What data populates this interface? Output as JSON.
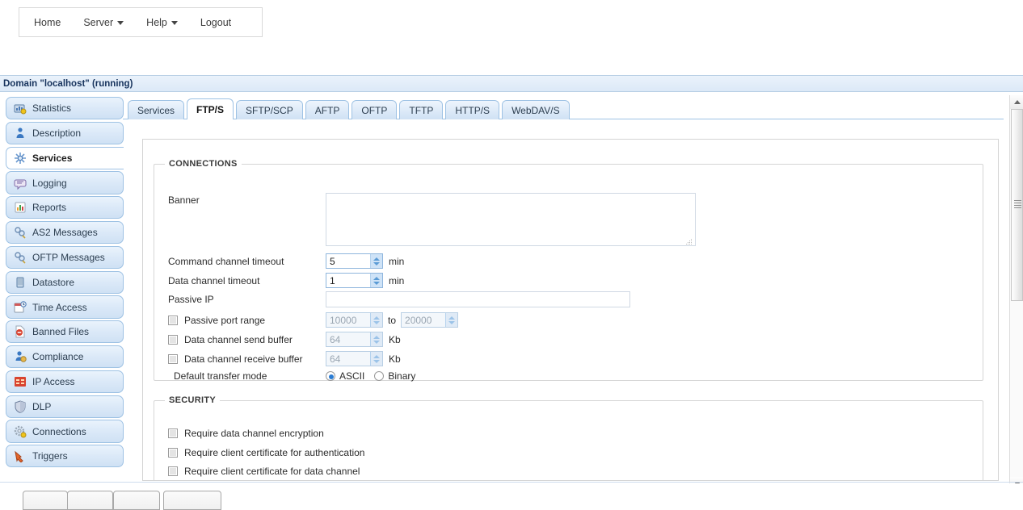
{
  "topnav": {
    "items": [
      {
        "label": "Home",
        "has_caret": false,
        "icon": null
      },
      {
        "label": "Server",
        "has_caret": true,
        "icon": "chevron-down-icon"
      },
      {
        "label": "Help",
        "has_caret": true,
        "icon": "chevron-down-icon"
      },
      {
        "label": "Logout",
        "has_caret": false,
        "icon": null
      }
    ]
  },
  "domain_bar": {
    "title": "Domain \"localhost\" (running)"
  },
  "sidebar": {
    "items": [
      {
        "label": "Statistics",
        "icon": "statistics-icon",
        "active": false
      },
      {
        "label": "Description",
        "icon": "description-icon",
        "active": false
      },
      {
        "label": "Services",
        "icon": "services-icon",
        "active": true
      },
      {
        "label": "Logging",
        "icon": "logging-icon",
        "active": false
      },
      {
        "label": "Reports",
        "icon": "reports-icon",
        "active": false
      },
      {
        "label": "AS2 Messages",
        "icon": "as2-messages-icon",
        "active": false
      },
      {
        "label": "OFTP Messages",
        "icon": "oftp-messages-icon",
        "active": false
      },
      {
        "label": "Datastore",
        "icon": "datastore-icon",
        "active": false
      },
      {
        "label": "Time Access",
        "icon": "time-access-icon",
        "active": false
      },
      {
        "label": "Banned Files",
        "icon": "banned-files-icon",
        "active": false
      },
      {
        "label": "Compliance",
        "icon": "compliance-icon",
        "active": false
      },
      {
        "label": "IP Access",
        "icon": "ip-access-icon",
        "active": false
      },
      {
        "label": "DLP",
        "icon": "dlp-icon",
        "active": false
      },
      {
        "label": "Connections",
        "icon": "connections-icon",
        "active": false
      },
      {
        "label": "Triggers",
        "icon": "triggers-icon",
        "active": false
      }
    ]
  },
  "tabs": [
    {
      "label": "Services",
      "active": false
    },
    {
      "label": "FTP/S",
      "active": true
    },
    {
      "label": "SFTP/SCP",
      "active": false
    },
    {
      "label": "AFTP",
      "active": false
    },
    {
      "label": "OFTP",
      "active": false
    },
    {
      "label": "TFTP",
      "active": false
    },
    {
      "label": "HTTP/S",
      "active": false
    },
    {
      "label": "WebDAV/S",
      "active": false
    }
  ],
  "connections": {
    "legend": "CONNECTIONS",
    "banner": {
      "label": "Banner",
      "value": "",
      "placeholder": ""
    },
    "command_channel_timeout": {
      "label": "Command channel timeout",
      "value": "5",
      "unit": "min",
      "enabled": true
    },
    "data_channel_timeout": {
      "label": "Data channel timeout",
      "value": "1",
      "unit": "min",
      "enabled": true
    },
    "passive_ip": {
      "label": "Passive IP",
      "value": "",
      "placeholder": ""
    },
    "passive_port_range": {
      "label": "Passive port range",
      "checked": false,
      "from": "10000",
      "to_separator": "to",
      "to": "20000",
      "enabled": false
    },
    "data_channel_send_buffer": {
      "label": "Data channel send buffer",
      "checked": false,
      "value": "64",
      "unit": "Kb",
      "enabled": false
    },
    "data_channel_receive_buffer": {
      "label": "Data channel receive buffer",
      "checked": false,
      "value": "64",
      "unit": "Kb",
      "enabled": false
    },
    "default_transfer_mode": {
      "label": "Default transfer mode",
      "options": [
        {
          "label": "ASCII",
          "selected": true
        },
        {
          "label": "Binary",
          "selected": false
        }
      ]
    }
  },
  "security": {
    "legend": "SECURITY",
    "checkboxes": [
      {
        "label": "Require data channel encryption",
        "checked": false
      },
      {
        "label": "Require client certificate for authentication",
        "checked": false
      },
      {
        "label": "Require client certificate for data channel",
        "checked": false
      }
    ]
  },
  "scrollbar": {
    "up_icon": "scroll-up-arrow-icon",
    "down_icon": "scroll-down-arrow-icon",
    "thumb_icon": "scrollbar-thumb"
  },
  "colors": {
    "accent_blue": "#2b7cd3",
    "panel_border": "#d4d4d4",
    "sidebar_border": "#9ec2e4",
    "domain_bar_text": "#16325c"
  }
}
